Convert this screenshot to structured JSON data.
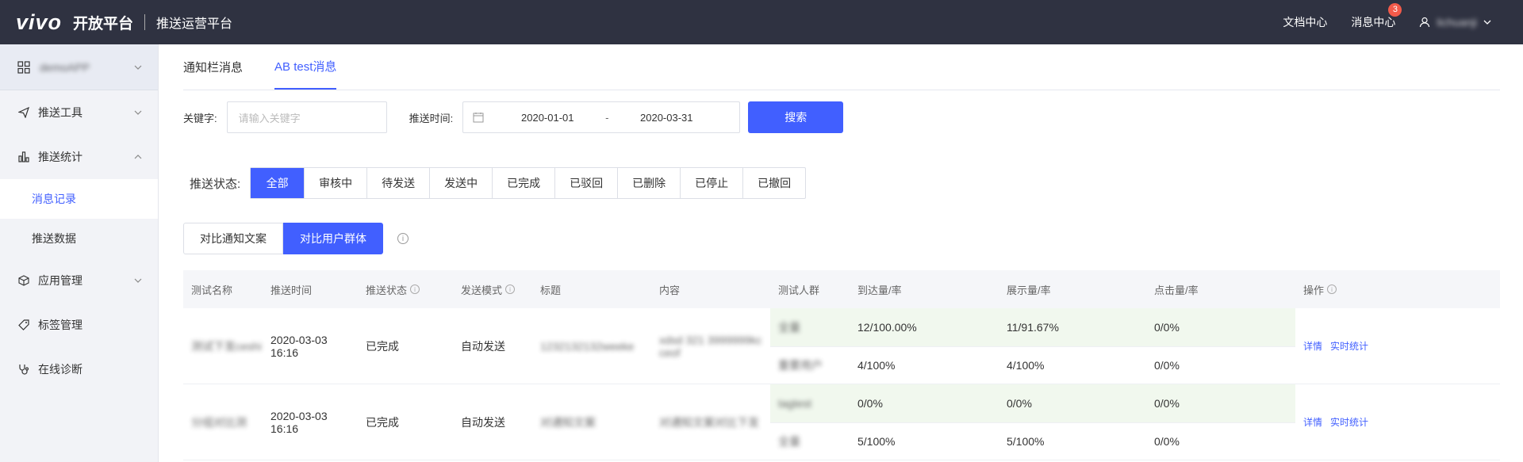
{
  "header": {
    "logo": "vivo",
    "logo_sub": "开放平台",
    "title": "推送运营平台",
    "doc_center": "文档中心",
    "msg_center": "消息中心",
    "msg_badge": "3",
    "user_name": "lichuanji"
  },
  "sidebar": {
    "app_name": "demoAPP",
    "items": [
      {
        "label": "推送工具",
        "icon": "send-icon"
      },
      {
        "label": "推送统计",
        "icon": "bar-chart-icon"
      },
      {
        "label": "应用管理",
        "icon": "cube-icon"
      },
      {
        "label": "标签管理",
        "icon": "tag-icon"
      },
      {
        "label": "在线诊断",
        "icon": "stethoscope-icon"
      }
    ],
    "sub_items": [
      "消息记录",
      "推送数据"
    ]
  },
  "tabs": [
    "通知栏消息",
    "AB test消息"
  ],
  "filter": {
    "keyword_label": "关键字:",
    "keyword_placeholder": "请输入关键字",
    "time_label": "推送时间:",
    "start_date": "2020-01-01",
    "sep": "-",
    "end_date": "2020-03-31",
    "search": "搜索"
  },
  "status": {
    "label": "推送状态:",
    "options": [
      "全部",
      "审核中",
      "待发送",
      "发送中",
      "已完成",
      "已驳回",
      "已删除",
      "已停止",
      "已撤回"
    ]
  },
  "compare": {
    "options": [
      "对比通知文案",
      "对比用户群体"
    ]
  },
  "table": {
    "headers": [
      "测试名称",
      "推送时间",
      "推送状态",
      "发送模式",
      "标题",
      "内容",
      "测试人群",
      "到达量/率",
      "展示量/率",
      "点击量/率",
      "操作"
    ],
    "groups": [
      {
        "name": "测试下发ceshi",
        "time": "2020-03-03 16:16",
        "status": "已完成",
        "mode": "自动发送",
        "title": "1232132132weeke",
        "content": "xdsd 321 3999999kc ceof",
        "rows": [
          {
            "crowd": "全量",
            "arrive": "12/100.00%",
            "show": "11/91.67%",
            "click": "0/0%"
          },
          {
            "crowd": "重要用户",
            "arrive": "4/100%",
            "show": "4/100%",
            "click": "0/0%"
          }
        ],
        "op_detail": "详情",
        "op_stats": "实时统计"
      },
      {
        "name": "分组对比测",
        "time": "2020-03-03 16:16",
        "status": "已完成",
        "mode": "自动发送",
        "title": "对通知文案",
        "content": "对通知文案对比下发",
        "rows": [
          {
            "crowd": "tagtest",
            "arrive": "0/0%",
            "show": "0/0%",
            "click": "0/0%"
          },
          {
            "crowd": "全量",
            "arrive": "5/100%",
            "show": "5/100%",
            "click": "0/0%"
          }
        ],
        "op_detail": "详情",
        "op_stats": "实时统计"
      }
    ]
  }
}
